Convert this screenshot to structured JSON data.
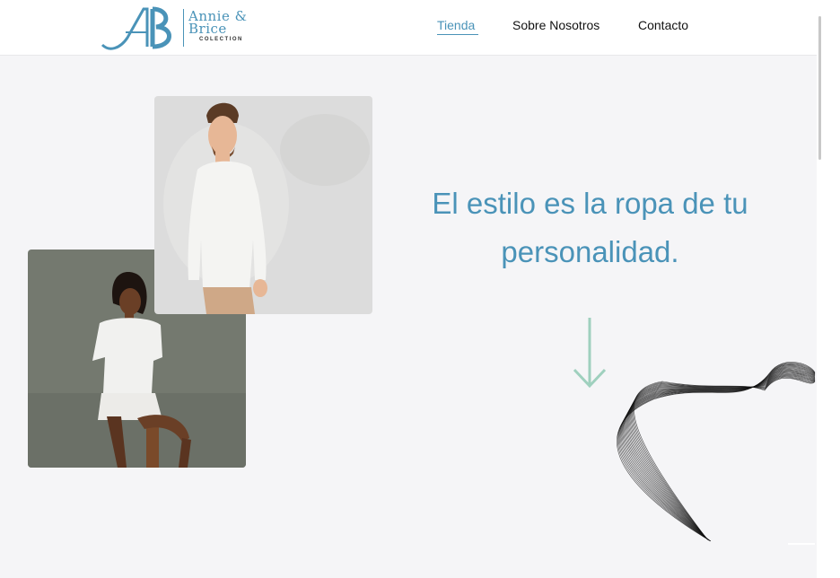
{
  "brand": {
    "monogram": "AB",
    "name": "Annie &\nBrice",
    "tagline": "COLECTION"
  },
  "nav": {
    "items": [
      {
        "label": "Tienda",
        "active": true
      },
      {
        "label": "Sobre Nosotros",
        "active": false
      },
      {
        "label": "Contacto",
        "active": false
      }
    ]
  },
  "hero": {
    "headline": "El estilo es la ropa de tu personalidad.",
    "scroll_icon": "arrow-down-icon",
    "accent_color": "#4a93b8",
    "arrow_color": "#9fd0be"
  },
  "images": {
    "man": "man-white-sweater-photo",
    "woman": "woman-white-outfit-photo",
    "decoration": "wave-ribbon-graphic"
  }
}
